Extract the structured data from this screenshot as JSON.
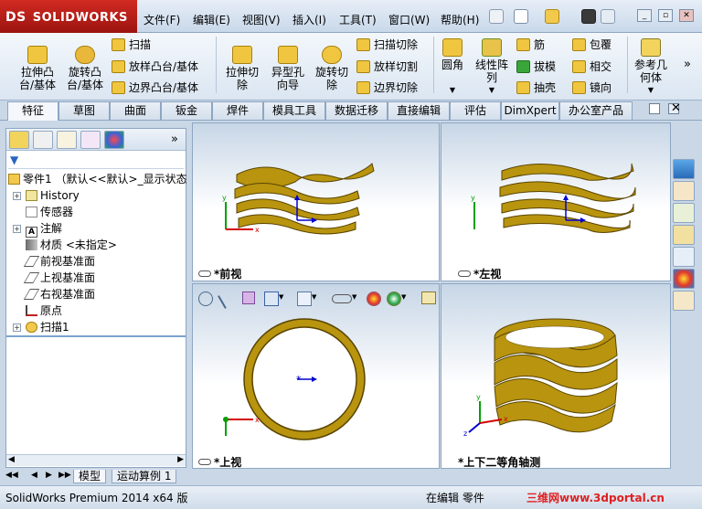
{
  "app": {
    "logo_text": "SOLIDWORKS",
    "logo_prefix": "DS"
  },
  "menu": [
    "文件(F)",
    "编辑(E)",
    "视图(V)",
    "插入(I)",
    "工具(T)",
    "窗口(W)",
    "帮助(H)"
  ],
  "ribbon": {
    "extrude_boss": "拉伸凸\n台/基体",
    "revolve_boss": "旋转凸\n台/基体",
    "sweep": "扫描",
    "loft_boss": "放样凸台/基体",
    "boundary_boss": "边界凸台/基体",
    "extrude_cut": "拉伸切\n除",
    "hole_wizard": "异型孔\n向导",
    "revolve_cut": "旋转切\n除",
    "sweep_cut": "扫描切除",
    "loft_cut": "放样切割",
    "boundary_cut": "边界切除",
    "fillet": "圆角",
    "linear_pattern": "线性阵\n列",
    "rib": "筋",
    "draft": "拔模",
    "shell": "抽壳",
    "wrap": "包覆",
    "intersect": "相交",
    "mirror": "镜向",
    "ref_geometry": "参考几\n何体",
    "more": "»"
  },
  "tabs": [
    "特征",
    "草图",
    "曲面",
    "钣金",
    "焊件",
    "模具工具",
    "数据迁移",
    "直接编辑",
    "评估",
    "DimXpert",
    "办公室产品"
  ],
  "feature_tree": {
    "part": "零件1 （默认<<默认>_显示状态",
    "items": [
      "History",
      "传感器",
      "注解",
      "材质 <未指定>",
      "前视基准面",
      "上视基准面",
      "右视基准面",
      "原点",
      "扫描1"
    ]
  },
  "viewports": {
    "front": "*前视",
    "left": "*左视",
    "top": "*上视",
    "iso": "*上下二等角轴测"
  },
  "bottom_tabs": [
    "模型",
    "运动算例 1"
  ],
  "status": {
    "product": "SolidWorks Premium 2014 x64 版",
    "mode": "在编辑 零件",
    "watermark": "三维网www.3dportal.cn"
  },
  "colors": {
    "spring_gold": "#b8940f",
    "spring_dark": "#5a4500",
    "logo_red": "#c01d16",
    "axis_red": "#d40000",
    "axis_green": "#00a000",
    "axis_blue": "#0000d0"
  }
}
